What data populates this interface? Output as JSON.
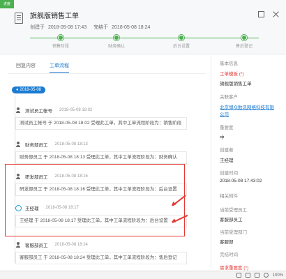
{
  "header": {
    "corner_tag": "进度",
    "title": "旗舰版销售工单",
    "created_label": "创建于",
    "created_value": "2018-05-08 17:43",
    "completed_label": "完结于",
    "completed_value": "2018-05-08 18:24",
    "steps": [
      "销售阶段",
      "财务确认",
      "后台设置",
      "售后登记"
    ]
  },
  "tabs": [
    "回复内容",
    "工单流程"
  ],
  "active_tab": "工单流程",
  "timeline": {
    "date": "2018-05-08",
    "entries": [
      {
        "name": "测试员工帐号",
        "time": "2018-05-08 18:02",
        "text": "测试员工帐号 于 2018-05-08 18:02 受理此工单，其中工单流程阶段为：销售阶段",
        "icon": "person-icon"
      },
      {
        "name": "财务部员工",
        "time": "2018-05-08 18:13",
        "text": "财务部员工 于 2018-05-08 18:13 受理此工单，其中工单流程阶段为：财务确认",
        "icon": "person-icon"
      },
      {
        "name": "研发部员工",
        "time": "2018-05-08 18:16",
        "text": "研发部员工 于 2018-05-08 18:16 受理此工单，其中工单流程阶段为：后台设置",
        "icon": "person-icon"
      },
      {
        "name": "王经理",
        "time": "2018-05-08 18:17",
        "text": "王经理 于 2018-05-08 18:17 受理此工单，其中工单流程阶段为：后台设置",
        "icon": "avatar-icon"
      },
      {
        "name": "客服部员工",
        "time": "2018-05-08 18:24",
        "text": "客服部员工 于 2018-05-08 18:24 受理此工单，其中工单流程阶段为：售后登记",
        "icon": "person-icon"
      }
    ]
  },
  "info": {
    "section_title": "基本信息",
    "template_label": "工单模板 (*)",
    "template_value": "旗舰版销售工单",
    "customer_label": "关联客户",
    "customer_value_1": "北京博众数讯网络科技有限",
    "customer_value_2": "公司",
    "priority_label": "重要度",
    "priority_value": "中",
    "creator_label": "创建者",
    "creator_value": "王经理",
    "created_time_label": "创建时间",
    "created_time_value": "2018-05-08 17:43:02",
    "attachment_label": "相关附件",
    "current_handler_label": "当前受理员工",
    "current_handler_value": "客服部员工",
    "current_dept_label": "当前受理部门",
    "current_dept_value": "客服部",
    "finish_time_label": "完结时间",
    "requirement_label": "需求重要度 (*)"
  },
  "statusbar": {
    "zoom": "100%"
  },
  "colors": {
    "accent": "#1a7bd1",
    "progress": "#4caf50",
    "highlight": "#e53935"
  }
}
